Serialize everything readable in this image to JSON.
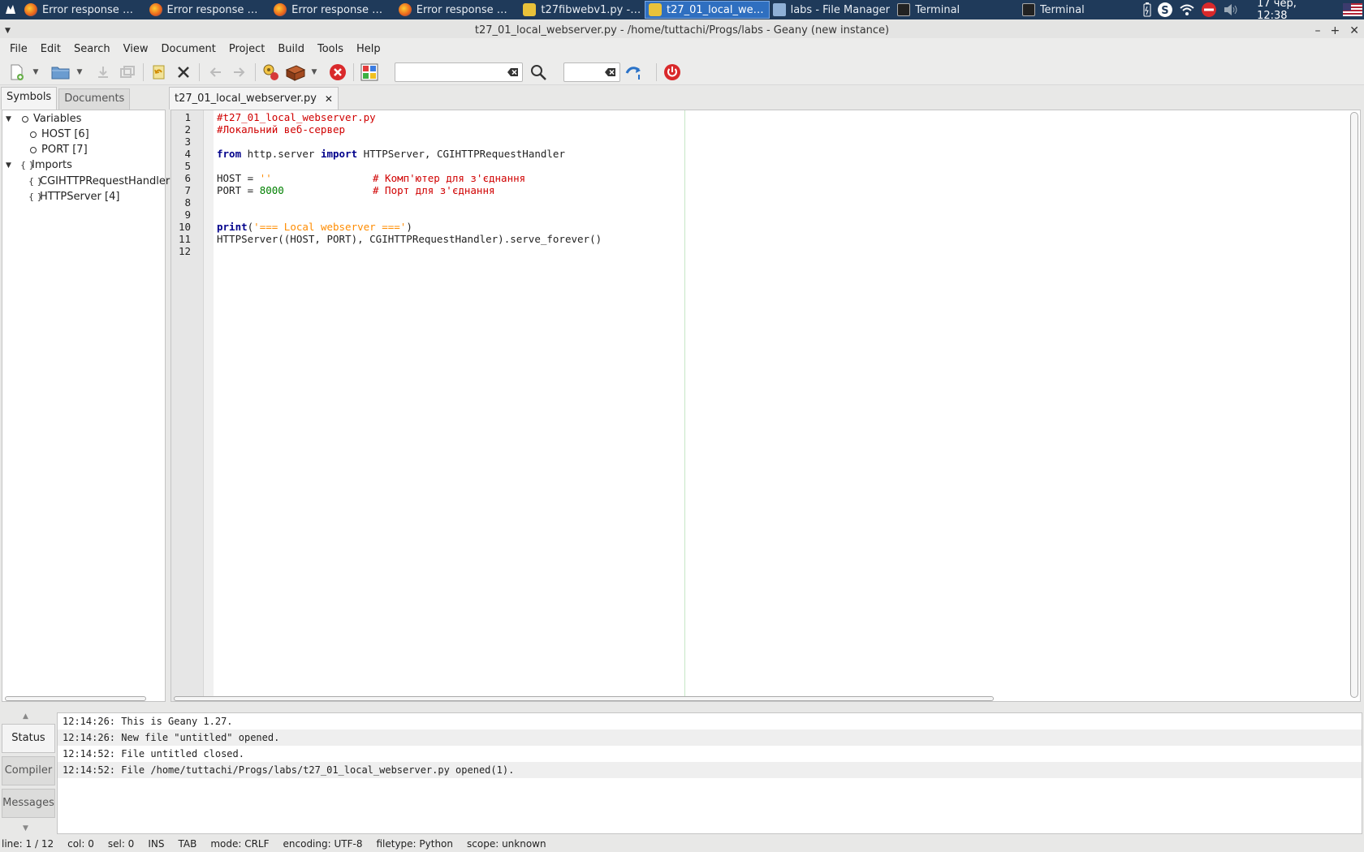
{
  "taskbar": {
    "tasks": [
      {
        "label": "Error response — M...",
        "icon": "firefox-icon"
      },
      {
        "label": "Error response — M...",
        "icon": "firefox-icon"
      },
      {
        "label": "Error response — M...",
        "icon": "firefox-icon"
      },
      {
        "label": "Error response — M...",
        "icon": "firefox-icon"
      },
      {
        "label": "t27fibwebv1.py - /ho...",
        "icon": "geany-icon"
      },
      {
        "label": "t27_01_local_webser...",
        "icon": "geany-icon"
      },
      {
        "label": "labs - File Manager",
        "icon": "folder-icon"
      },
      {
        "label": "Terminal",
        "icon": "terminal-icon"
      },
      {
        "label": "Terminal",
        "icon": "terminal-icon"
      }
    ],
    "active_task_index": 5,
    "clock": "17 чер, 12:38"
  },
  "window": {
    "title": "t27_01_local_webserver.py - /home/tuttachi/Progs/labs - Geany (new instance)"
  },
  "menu": {
    "items": [
      "File",
      "Edit",
      "Search",
      "View",
      "Document",
      "Project",
      "Build",
      "Tools",
      "Help"
    ]
  },
  "toolbar": {
    "search_value": "",
    "goto_line_value": ""
  },
  "sidebar": {
    "tabs": [
      "Symbols",
      "Documents"
    ],
    "active_tab": "Symbols",
    "tree": {
      "variables_label": "Variables",
      "variables": [
        "HOST [6]",
        "PORT [7]"
      ],
      "imports_label": "Imports",
      "imports": [
        "CGIHTTPRequestHandler",
        "HTTPServer [4]"
      ]
    }
  },
  "editor": {
    "tab_label": "t27_01_local_webserver.py",
    "line_numbers": [
      "1",
      "2",
      "3",
      "4",
      "5",
      "6",
      "7",
      "8",
      "9",
      "10",
      "11",
      "12"
    ],
    "code": {
      "l1": "#t27_01_local_webserver.py",
      "l2": "#Локальний веб-сервер",
      "l4_from": "from",
      "l4_mod": " http.server ",
      "l4_import": "import",
      "l4_rest": " HTTPServer, CGIHTTPRequestHandler",
      "l6_host": "HOST = ",
      "l6_str": "''",
      "l6_comment": "# Комп'ютер для з'єднання",
      "l7_port": "PORT = ",
      "l7_num": "8000",
      "l7_comment": "# Порт для з'єднання",
      "l10_print": "print",
      "l10_paren_open": "(",
      "l10_str": "'=== Local webserver ==='",
      "l10_paren_close": ")",
      "l11": "HTTPServer((HOST, PORT), CGIHTTPRequestHandler).serve_forever()"
    }
  },
  "messages": {
    "tabs": [
      "Status",
      "Compiler",
      "Messages"
    ],
    "active_tab": "Status",
    "log": [
      "12:14:26: This is Geany 1.27.",
      "12:14:26: New file \"untitled\" opened.",
      "12:14:52: File untitled closed.",
      "12:14:52: File /home/tuttachi/Progs/labs/t27_01_local_webserver.py opened(1)."
    ]
  },
  "statusbar": {
    "line": "line: 1 / 12",
    "col": "col: 0",
    "sel": "sel: 0",
    "ins": "INS",
    "tab": "TAB",
    "mode": "mode: CRLF",
    "encoding": "encoding: UTF-8",
    "filetype": "filetype: Python",
    "scope": "scope: unknown"
  }
}
